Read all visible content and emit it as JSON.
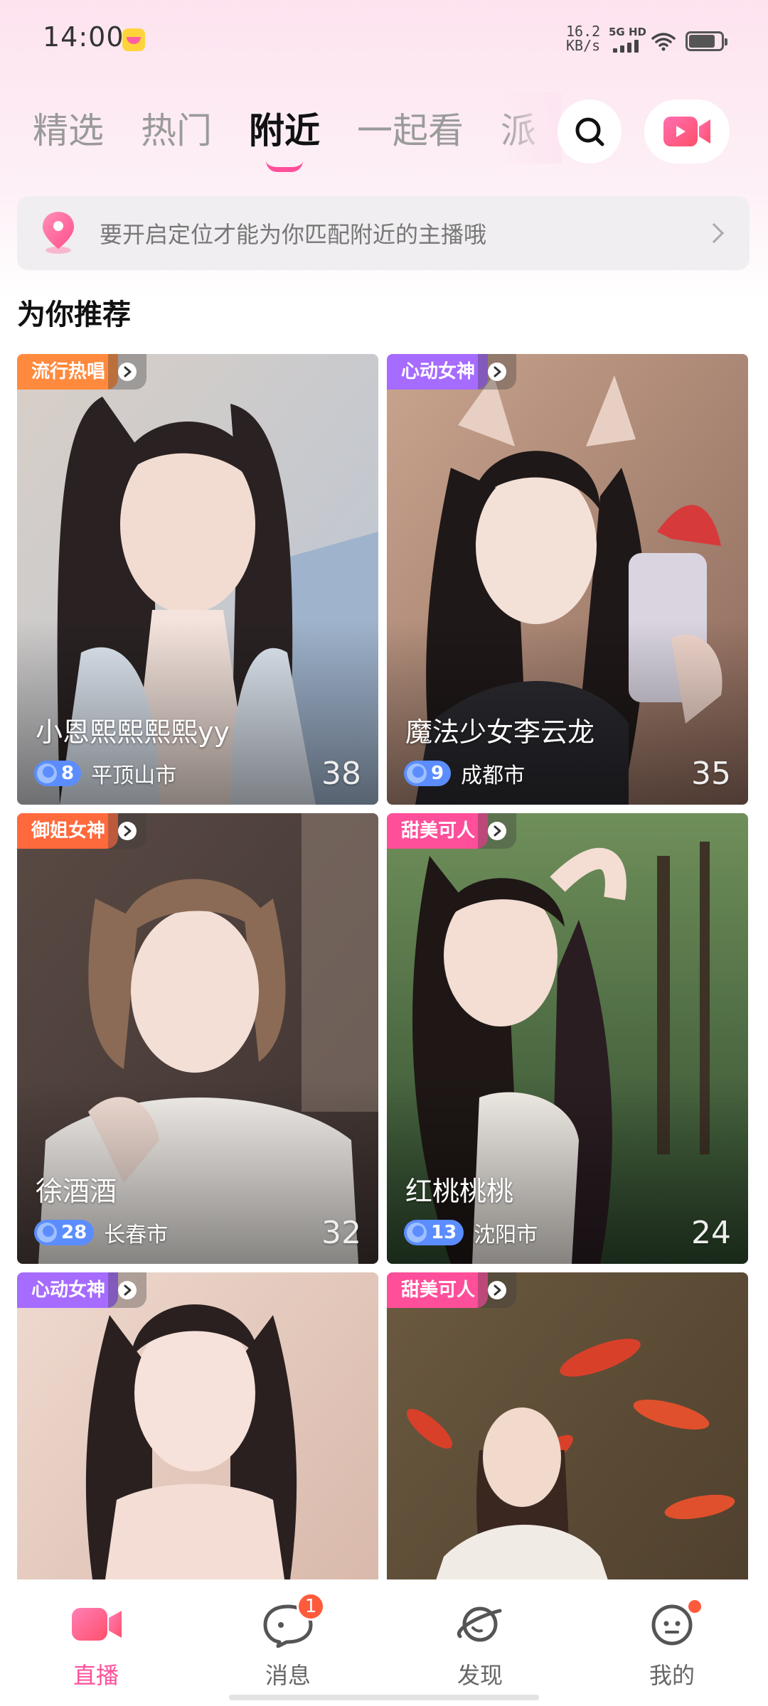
{
  "status_bar": {
    "time": "14:00",
    "speed_value": "16.2",
    "speed_unit": "KB/s",
    "network": "5G HD"
  },
  "tabs": [
    {
      "label": "精选",
      "active": false
    },
    {
      "label": "热门",
      "active": false
    },
    {
      "label": "附近",
      "active": true
    },
    {
      "label": "一起看",
      "active": false
    },
    {
      "label": "派",
      "active": false
    }
  ],
  "location_banner": {
    "text": "要开启定位才能为你匹配附近的主播哦"
  },
  "section_title": "为你推荐",
  "cards": [
    {
      "tag": "流行热唱",
      "tag_color": "#ff8a3d",
      "name": "小恩熙熙熙熙yy",
      "level": "8",
      "city": "平顶山市",
      "count": "38"
    },
    {
      "tag": "心动女神",
      "tag_color": "#a66bff",
      "name": "魔法少女李云龙",
      "level": "9",
      "city": "成都市",
      "count": "35"
    },
    {
      "tag": "御姐女神",
      "tag_color": "#ff6a3d",
      "name": "徐酒酒",
      "level": "28",
      "city": "长春市",
      "count": "32"
    },
    {
      "tag": "甜美可人",
      "tag_color": "#ff4f9a",
      "name": "红桃桃桃",
      "level": "13",
      "city": "沈阳市",
      "count": "24"
    },
    {
      "tag": "心动女神",
      "tag_color": "#a66bff",
      "name": "",
      "level": "",
      "city": "",
      "count": ""
    },
    {
      "tag": "甜美可人",
      "tag_color": "#ff4f9a",
      "name": "",
      "level": "",
      "city": "",
      "count": ""
    }
  ],
  "bottom_nav": [
    {
      "label": "直播",
      "icon": "live-camera-icon",
      "active": true
    },
    {
      "label": "消息",
      "icon": "chat-bubble-icon",
      "badge": "1"
    },
    {
      "label": "发现",
      "icon": "planet-icon"
    },
    {
      "label": "我的",
      "icon": "profile-face-icon",
      "dot": true
    }
  ],
  "colors": {
    "accent": "#ff4f9a",
    "badge_red": "#ff5a3c",
    "level_blue": "#5b8dff"
  }
}
